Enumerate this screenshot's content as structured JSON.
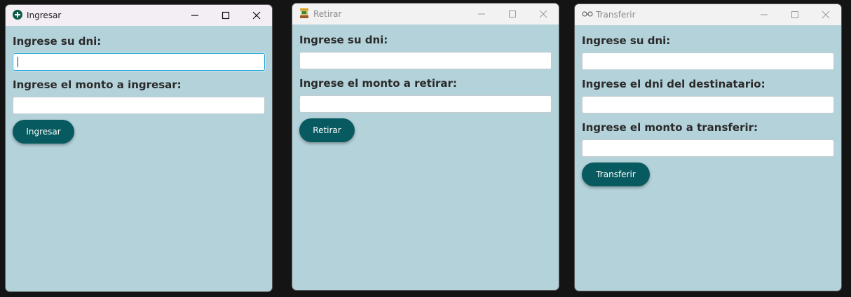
{
  "windows": {
    "ingresar": {
      "title": "Ingresar",
      "dni_label": "Ingrese su dni:",
      "amount_label": "Ingrese el monto a ingresar:",
      "dni_value": "",
      "amount_value": "",
      "button_label": "Ingresar",
      "icon": "plus-circle-icon"
    },
    "retirar": {
      "title": "Retirar",
      "dni_label": "Ingrese su dni:",
      "amount_label": "Ingrese el monto a retirar:",
      "dni_value": "",
      "amount_value": "",
      "button_label": "Retirar",
      "icon": "atm-withdraw-icon"
    },
    "transferir": {
      "title": "Transferir",
      "dni_label": "Ingrese su dni:",
      "recipient_label": "Ingrese el dni del destinatario:",
      "amount_label": "Ingrese el monto a transferir:",
      "dni_value": "",
      "recipient_value": "",
      "amount_value": "",
      "button_label": "Transferir",
      "icon": "money-transfer-icon"
    }
  },
  "colors": {
    "window_bg": "#b4d2da",
    "button_bg": "#075a60",
    "focus_border": "#1ea3d6",
    "desktop_bg": "#141414"
  }
}
